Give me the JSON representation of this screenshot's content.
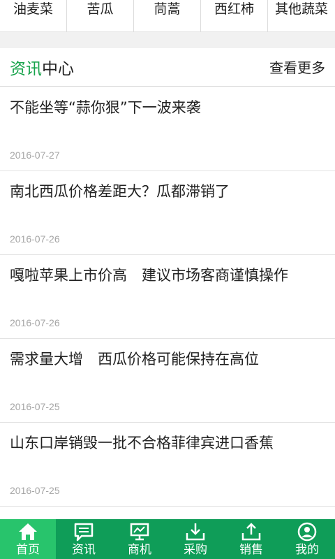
{
  "categories": [
    "油麦菜",
    "苦瓜",
    "茼蒿",
    "西红柿",
    "其他蔬菜"
  ],
  "section": {
    "title_accent": "资讯",
    "title_rest": "中心",
    "more_label": "查看更多"
  },
  "news": [
    {
      "title": "不能坐等“蒜你狠”下一波来袭",
      "date": "2016-07-27"
    },
    {
      "title": "南北西瓜价格差距大？瓜都滞销了",
      "date": "2016-07-26"
    },
    {
      "title": "嘎啦苹果上市价高　建议市场客商谨慎操作",
      "date": "2016-07-26"
    },
    {
      "title": "需求量大增　西瓜价格可能保持在高位",
      "date": "2016-07-25"
    },
    {
      "title": "山东口岸销毁一批不合格菲律宾进口香蕉",
      "date": "2016-07-25"
    }
  ],
  "nav": [
    {
      "label": "首页",
      "icon": "home-icon",
      "active": true
    },
    {
      "label": "资讯",
      "icon": "message-icon",
      "active": false
    },
    {
      "label": "商机",
      "icon": "monitor-icon",
      "active": false
    },
    {
      "label": "采购",
      "icon": "download-icon",
      "active": false
    },
    {
      "label": "销售",
      "icon": "upload-icon",
      "active": false
    },
    {
      "label": "我的",
      "icon": "user-icon",
      "active": false
    }
  ],
  "colors": {
    "accent": "#16a34a",
    "nav_bg": "#0f9d58",
    "nav_active": "#28c46c"
  }
}
